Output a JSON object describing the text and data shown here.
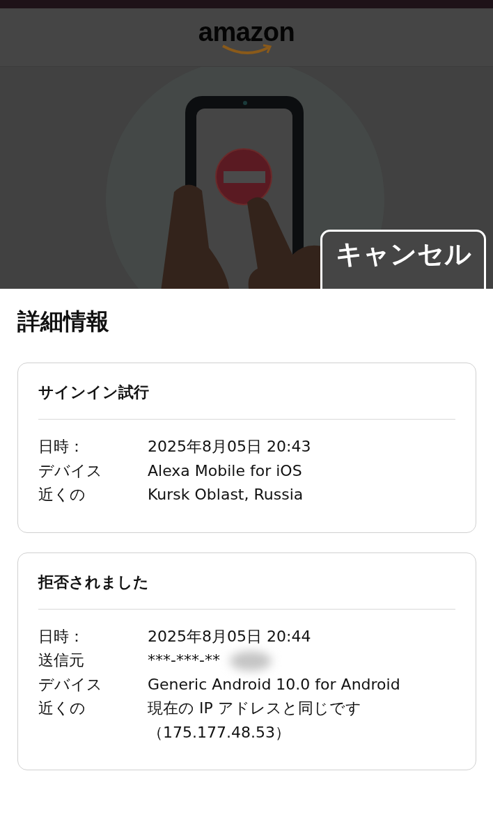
{
  "header": {
    "logo": "amazon"
  },
  "cancel_button": {
    "label": "キャンセル"
  },
  "sheet": {
    "title": "詳細情報",
    "cards": [
      {
        "title": "サインイン試行",
        "rows": [
          {
            "label": "日時：",
            "value": "2025年8月05日 20:43"
          },
          {
            "label": "デバイス",
            "value": "Alexa Mobile for iOS"
          },
          {
            "label": "近くの",
            "value": "Kursk Oblast, Russia"
          }
        ]
      },
      {
        "title": "拒否されました",
        "rows": [
          {
            "label": "日時：",
            "value": "2025年8月05日 20:44"
          },
          {
            "label": "送信元",
            "value": "***-***-**",
            "blurred": true
          },
          {
            "label": "デバイス",
            "value": "Generic Android 10.0 for Android"
          },
          {
            "label": "近くの",
            "values": [
              "現在の IP アドレスと同じです",
              "（175.177.48.53）"
            ]
          }
        ]
      }
    ]
  }
}
